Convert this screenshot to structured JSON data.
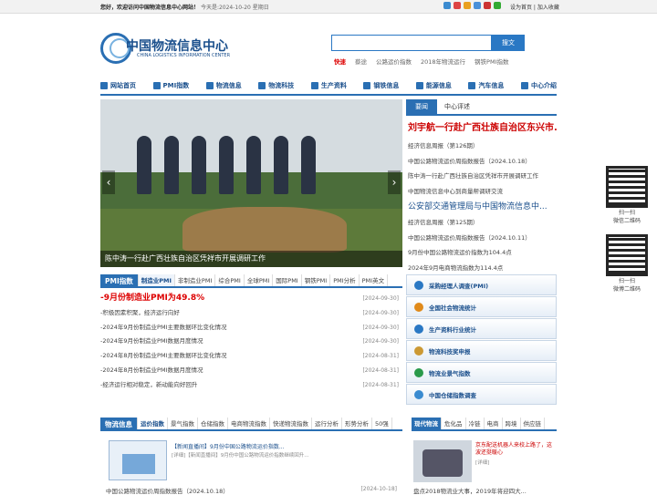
{
  "topbar": {
    "welcome": "您好，欢迎访问中国物流信息中心网站！",
    "date": "今天是:2024-10-20 星期日",
    "links": "设为首页 | 加入收藏"
  },
  "logo": {
    "cn": "中国物流信息中心",
    "en": "CHINA LOGISTICS INFORMATION CENTER"
  },
  "search": {
    "button": "搜文"
  },
  "hotkeys": [
    "快速",
    "蔡途",
    "公路运价指数",
    "2018年物流运行",
    "钢铁PMI指数"
  ],
  "nav": [
    "网站首页",
    "PMI指数",
    "物流信息",
    "物流科技",
    "生产资料",
    "钢铁信息",
    "能源信息",
    "汽车信息",
    "中心介绍"
  ],
  "slider": {
    "caption": "陈中涛一行赴广西壮族自治区凭祥市开展调研工作"
  },
  "right_tabs": [
    "要闻",
    "中心评述"
  ],
  "right_list": {
    "headline": "刘宇航一行赴广西壮族自治区东兴市...",
    "items1": [
      "经济信息周报（第126期）",
      "中国公路物流运价周指数报告（2024.10.18）",
      "陈中涛一行赴广西壮族自治区凭祥市开展调研工作",
      "中国物流信息中心到商量帮调研交流"
    ],
    "headline2": "公安部交通管理局与中国物流信息中...",
    "items2": [
      "经济信息周报（第125期）",
      "中国公路物流运价周指数报告（2024.10.11）",
      "9月份中国公路物流运价指数为104.4点",
      "2024年9月电商物流指数为114.4点"
    ]
  },
  "qr": [
    "扫一扫",
    "微信二维码",
    "扫一扫",
    "微博二维码"
  ],
  "pmi": {
    "title": "PMI指数",
    "tabs": [
      "制造业PMI",
      "非制造业PMI",
      "综合PMI",
      "全球PMI",
      "国际PMI",
      "钢铁PMI",
      "PMI分析",
      "PMI英文"
    ],
    "rows": [
      {
        "t": "-9月份制造业PMI为49.8%",
        "d": "[2024-09-30]"
      },
      {
        "t": "-积极因素积聚，经济运行向好",
        "d": "[2024-09-30]"
      },
      {
        "t": "-2024年9月份制造业PMI主要数据环比变化情况",
        "d": "[2024-09-30]"
      },
      {
        "t": "-2024年9月份制造业PMI数据月度情况",
        "d": "[2024-09-30]"
      },
      {
        "t": "-2024年8月份制造业PMI主要数据环比变化情况",
        "d": "[2024-08-31]"
      },
      {
        "t": "-2024年8月份制造业PMI数据月度情况",
        "d": "[2024-08-31]"
      },
      {
        "t": "-经济运行相对稳定，新动能向好回升",
        "d": "[2024-08-31]"
      }
    ]
  },
  "side_buttons": [
    "采购经理人调查(PMI)",
    "全国社会物流统计",
    "生产资料行业统计",
    "物流科技奖申报",
    "物流业景气指数",
    "中国仓储指数调查"
  ],
  "news": {
    "title": "物流信息",
    "tabs": [
      "运价指数",
      "景气指数",
      "仓储指数",
      "电商物流指数",
      "快递物流指数",
      "运行分析",
      "形势分析",
      "50强"
    ],
    "feature_title": "【新闻直播间】9月份中国公路物流运价指数...",
    "feature_sub": "[详细]【新闻直播间】9月份中国公路物流运价指数继续回升...",
    "row": "中国公路物流运价周指数报告（2024.10.18）",
    "row_date": "[2024-10-18]"
  },
  "logistics": {
    "tabs": [
      "现代物流",
      "危化品",
      "冷链",
      "电商",
      "跨境",
      "供应链"
    ],
    "headline": "京东配送机器人来校上路了，这波还挺暖心",
    "more": "[详细]",
    "row": "盘点2018物流业大事，2019年将迎四大..."
  }
}
